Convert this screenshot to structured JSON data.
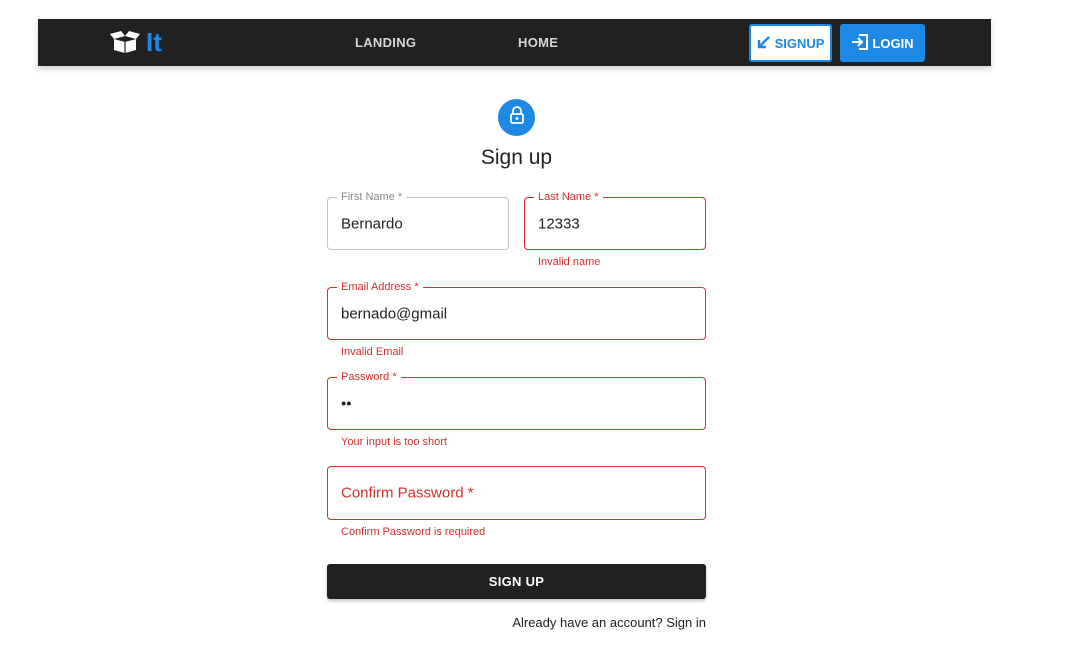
{
  "colors": {
    "appbar": "#212121",
    "primary": "#1e88e5",
    "error": "#d32f2f"
  },
  "nav": {
    "logo_icon": "box-open-icon",
    "logo_text": "It",
    "links": [
      "LANDING",
      "HOME"
    ],
    "signup_label": "SIGNUP",
    "signup_icon": "arrow-down-left-icon",
    "login_label": "LOGIN",
    "login_icon": "login-icon"
  },
  "form": {
    "avatar_icon": "lock-icon",
    "title": "Sign up",
    "first_name": {
      "label": "First Name *",
      "value": "Bernardo"
    },
    "last_name": {
      "label": "Last Name *",
      "value": "12333",
      "error": "Invalid name"
    },
    "email": {
      "label": "Email Address *",
      "value": "bernado@gmail",
      "error": "Invalid Email"
    },
    "password": {
      "label": "Password *",
      "value": "••",
      "error": "Your input is too short"
    },
    "confirm_password": {
      "placeholder": "Confirm Password *",
      "error": "Confirm Password is required"
    },
    "submit_label": "SIGN UP",
    "signin_text": "Already have an account? Sign in"
  }
}
